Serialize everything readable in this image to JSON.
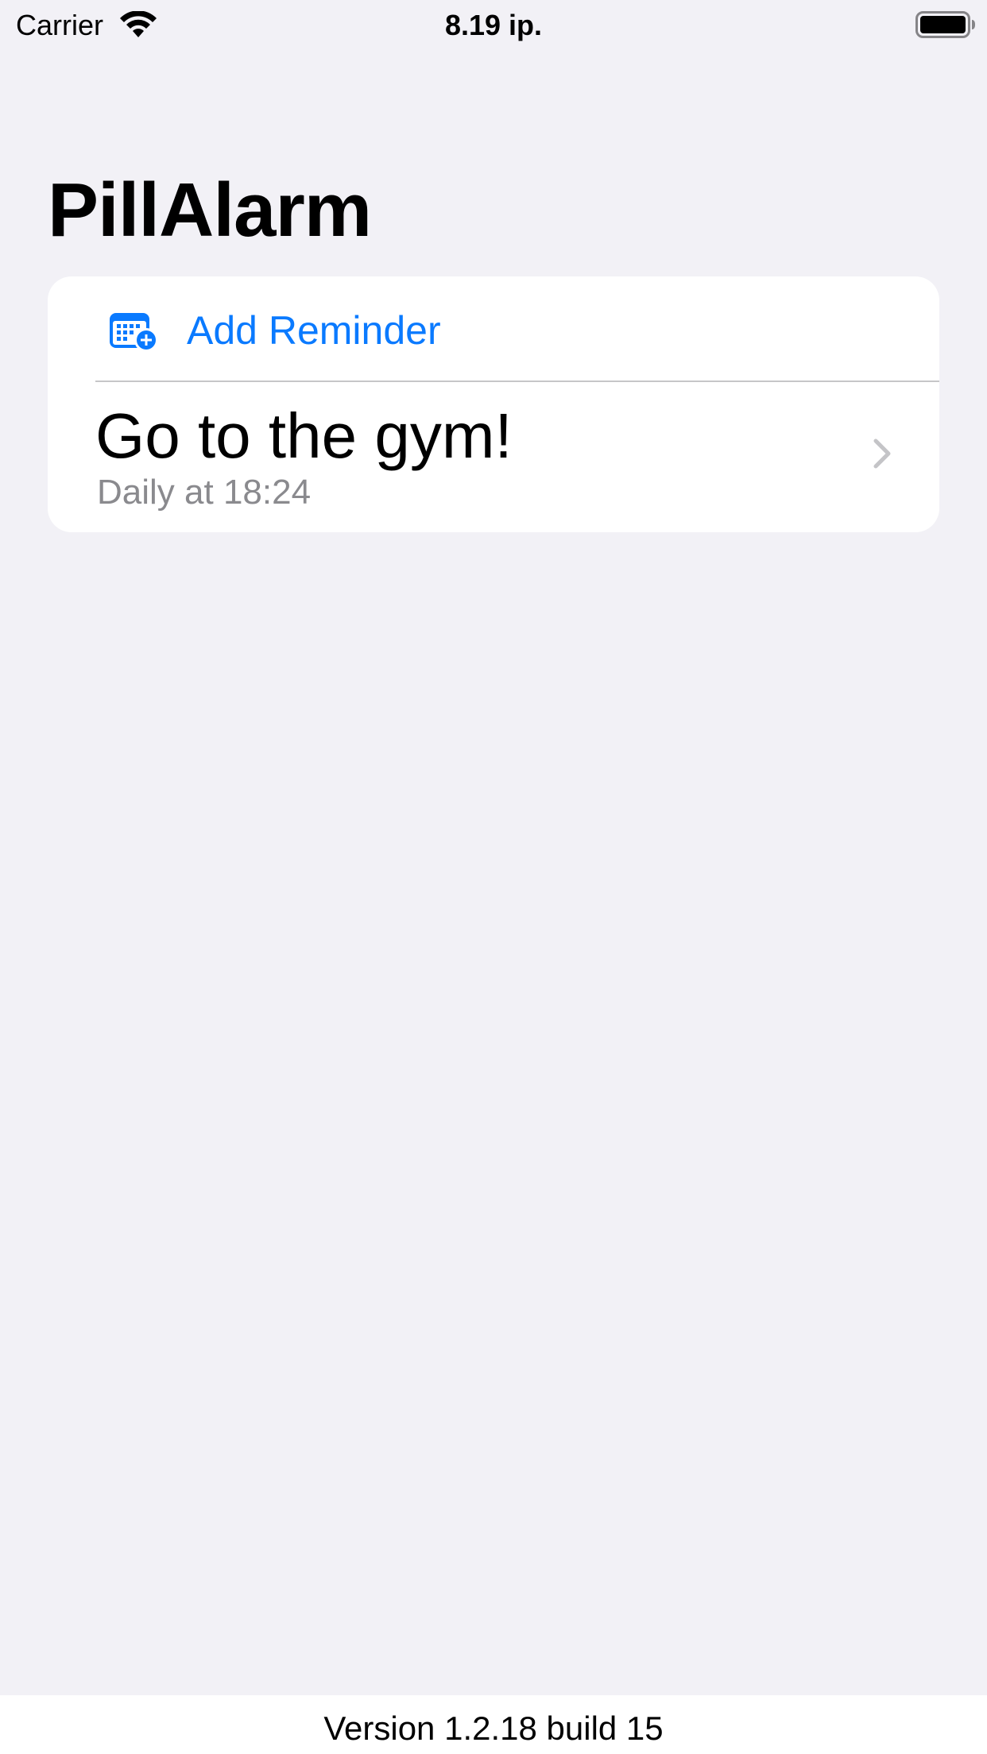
{
  "status_bar": {
    "carrier": "Carrier",
    "time": "8.19 ip.",
    "wifi_icon": "wifi-icon",
    "battery_icon": "battery-full-icon"
  },
  "header": {
    "title": "PillAlarm"
  },
  "list": {
    "add_button": {
      "label": "Add Reminder",
      "icon": "calendar-add-icon"
    },
    "reminders": [
      {
        "title": "Go to the gym!",
        "schedule": "Daily at 18:24"
      }
    ]
  },
  "footer": {
    "version": "Version 1.2.18 build 15"
  },
  "colors": {
    "accent": "#0A7AFF",
    "background": "#F2F1F6",
    "secondary_text": "#8A8A8E"
  }
}
